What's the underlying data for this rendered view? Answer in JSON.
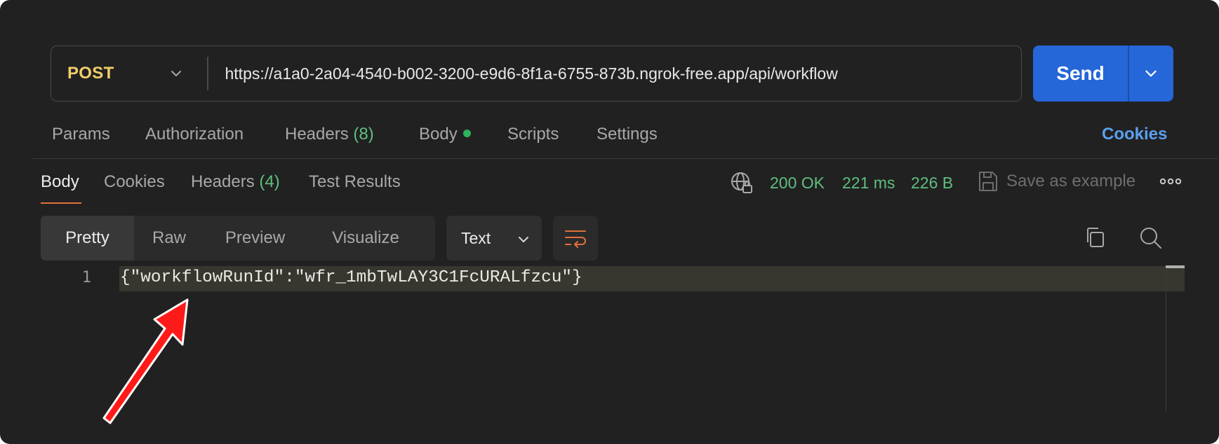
{
  "request": {
    "method": "POST",
    "url": "https://a1a0-2a04-4540-b002-3200-e9d6-8f1a-6755-873b.ngrok-free.app/api/workflow",
    "send_label": "Send",
    "tabs": [
      {
        "label": "Params"
      },
      {
        "label": "Authorization"
      },
      {
        "label": "Headers",
        "count": "(8)"
      },
      {
        "label": "Body"
      },
      {
        "label": "Scripts"
      },
      {
        "label": "Settings"
      }
    ],
    "cookies_label": "Cookies"
  },
  "response": {
    "tabs": [
      {
        "label": "Body"
      },
      {
        "label": "Cookies"
      },
      {
        "label": "Headers",
        "count": "(4)"
      },
      {
        "label": "Test Results"
      }
    ],
    "status": "200 OK",
    "time": "221 ms",
    "size": "226 B",
    "save_example_label": "Save as example",
    "views": [
      "Pretty",
      "Raw",
      "Preview",
      "Visualize"
    ],
    "active_view": "Pretty",
    "format": "Text",
    "lines": [
      {
        "number": "1",
        "text": "{\"workflowRunId\":\"wfr_1mbTwLAY3C1FcURALfzcu\"}"
      }
    ]
  },
  "colors": {
    "method": "#f0cf6a",
    "send": "#2566d8",
    "status": "#5fbf7f",
    "cookies_link": "#5aa0f0",
    "active_underline": "#e2703a",
    "annotation_arrow": "#ff1a1a"
  },
  "icons": [
    "chevron-down-icon",
    "globe-lock-icon",
    "save-icon",
    "more-horizontal-icon",
    "wrap-lines-icon",
    "copy-icon",
    "search-icon",
    "annotation-arrow"
  ]
}
